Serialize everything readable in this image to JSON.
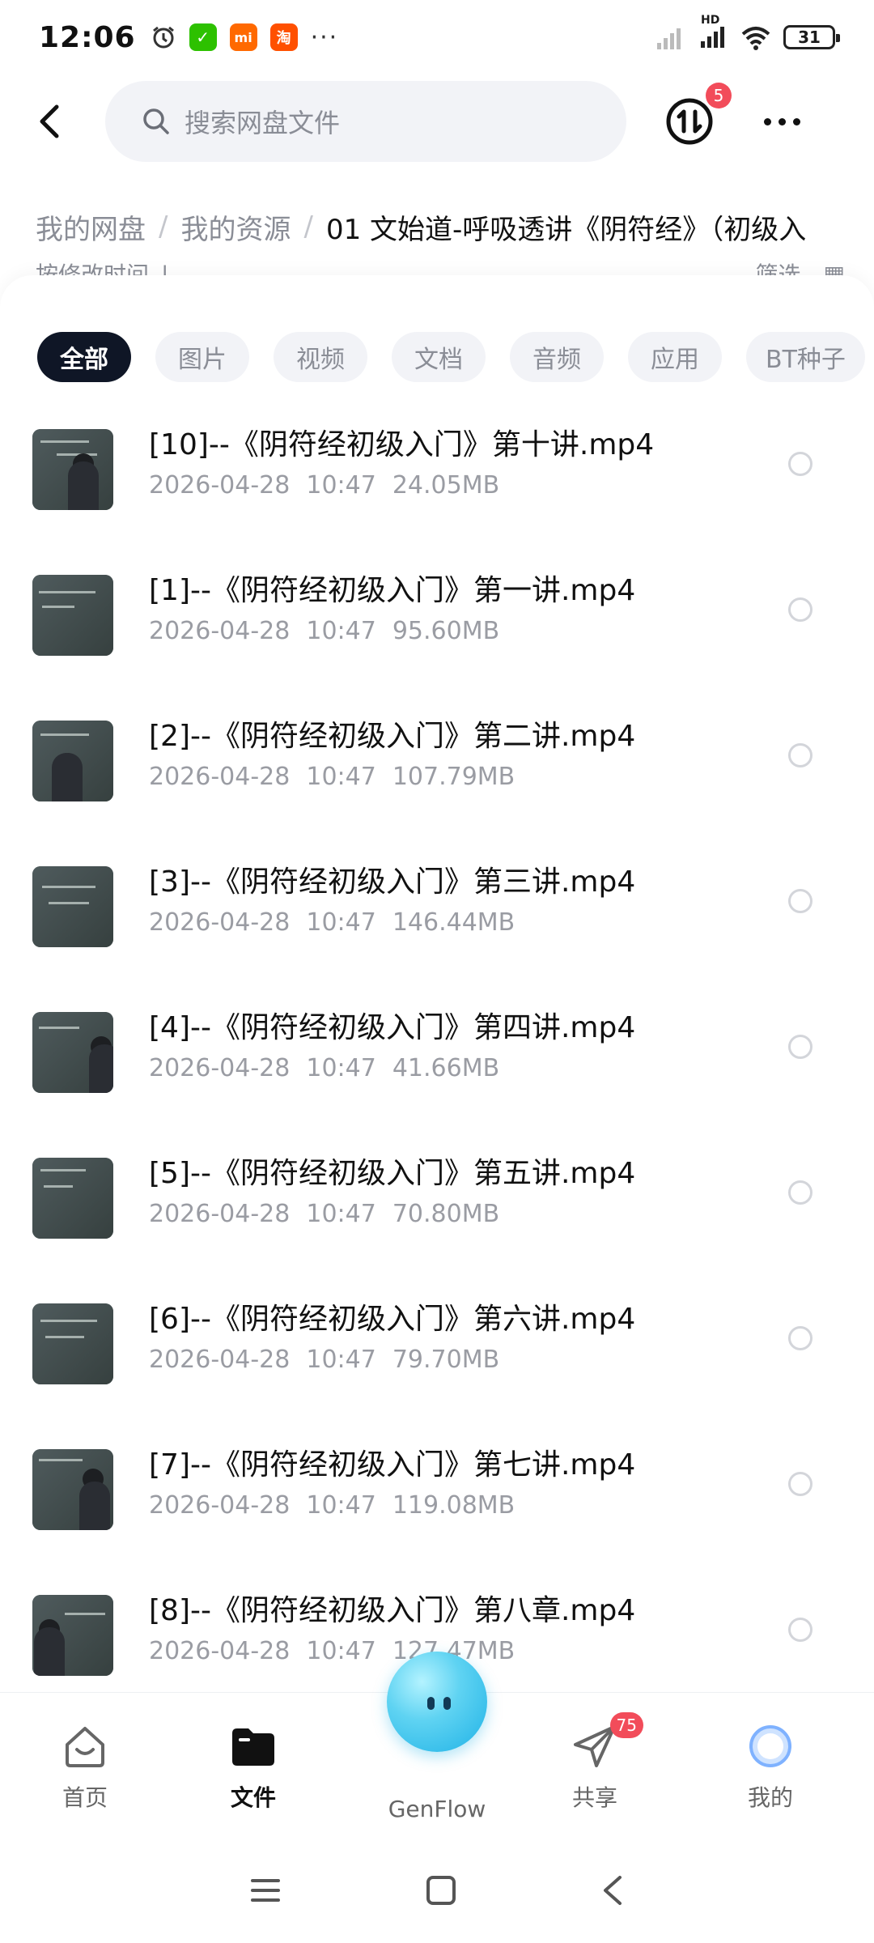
{
  "status_bar": {
    "time": "12:06",
    "apps": [
      {
        "icon": "wechat-icon",
        "color": "#2dc100",
        "glyph": "✓"
      },
      {
        "icon": "mi-icon",
        "color": "#ff6900",
        "glyph": "mi"
      },
      {
        "icon": "taobao-icon",
        "color": "#ff5000",
        "glyph": "淘"
      }
    ],
    "more": "···",
    "network": "HD",
    "battery": "31"
  },
  "header": {
    "search_placeholder": "搜索网盘文件",
    "transfer_badge": "5"
  },
  "breadcrumb": {
    "items": [
      "我的网盘",
      "我的资源"
    ],
    "current": "01 文始道-呼吸透讲《阴符经》（初级入"
  },
  "sort_row": {
    "sort_label": "按修改时间",
    "filter_label": "筛选"
  },
  "filters": [
    "全部",
    "图片",
    "视频",
    "文档",
    "音频",
    "应用",
    "BT种子"
  ],
  "files": [
    {
      "name": "[10]--《阴符经初级入门》第十讲.mp4",
      "date": "2026-04-28",
      "time": "10:47",
      "size": "24.05MB"
    },
    {
      "name": "[1]--《阴符经初级入门》第一讲.mp4",
      "date": "2026-04-28",
      "time": "10:47",
      "size": "95.60MB"
    },
    {
      "name": "[2]--《阴符经初级入门》第二讲.mp4",
      "date": "2026-04-28",
      "time": "10:47",
      "size": "107.79MB"
    },
    {
      "name": "[3]--《阴符经初级入门》第三讲.mp4",
      "date": "2026-04-28",
      "time": "10:47",
      "size": "146.44MB"
    },
    {
      "name": "[4]--《阴符经初级入门》第四讲.mp4",
      "date": "2026-04-28",
      "time": "10:47",
      "size": "41.66MB"
    },
    {
      "name": "[5]--《阴符经初级入门》第五讲.mp4",
      "date": "2026-04-28",
      "time": "10:47",
      "size": "70.80MB"
    },
    {
      "name": "[6]--《阴符经初级入门》第六讲.mp4",
      "date": "2026-04-28",
      "time": "10:47",
      "size": "79.70MB"
    },
    {
      "name": "[7]--《阴符经初级入门》第七讲.mp4",
      "date": "2026-04-28",
      "time": "10:47",
      "size": "119.08MB"
    },
    {
      "name": "[8]--《阴符经初级入门》第八章.mp4",
      "date": "2026-04-28",
      "time": "10:47",
      "size": "127.47MB"
    }
  ],
  "bottom_nav": {
    "items": [
      {
        "label": "首页",
        "icon": "home-icon"
      },
      {
        "label": "文件",
        "icon": "folder-icon",
        "active": true
      },
      {
        "label": "GenFlow",
        "icon": "genflow-icon"
      },
      {
        "label": "共享",
        "icon": "paper-plane-icon",
        "badge": "75"
      },
      {
        "label": "我的",
        "icon": "profile-icon"
      }
    ]
  }
}
